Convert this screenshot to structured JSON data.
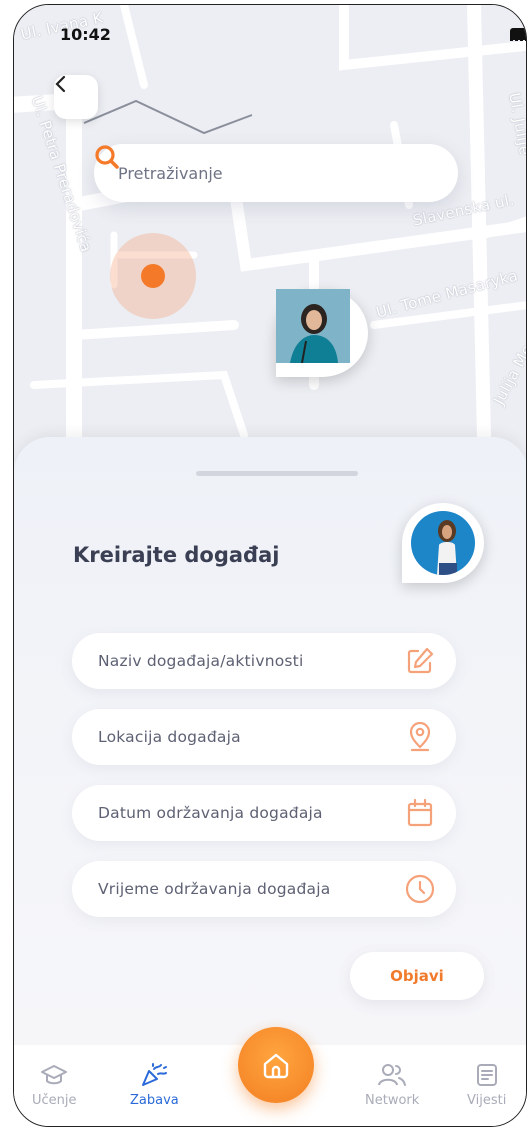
{
  "status_bar": {
    "time": "10:42"
  },
  "map": {
    "streets": [
      "Ul. Ivana K",
      "Ul. Petra Preradovića",
      "Slavenska ul.",
      "Ul. Tome Masaryka",
      "Julija Merlić",
      "Ul. Julije"
    ]
  },
  "search": {
    "placeholder": "Pretraživanje"
  },
  "sheet": {
    "title": "Kreirajte događaj",
    "fields": [
      {
        "label": "Naziv događaja/aktivnosti",
        "icon": "edit-icon"
      },
      {
        "label": "Lokacija događaja",
        "icon": "location-pin-icon"
      },
      {
        "label": "Datum održavanja događaja",
        "icon": "calendar-icon"
      },
      {
        "label": "Vrijeme održavanja događaja",
        "icon": "clock-icon"
      }
    ],
    "publish_label": "Objavi"
  },
  "nav": {
    "items": [
      {
        "label": "Učenje",
        "icon": "graduation-cap-icon"
      },
      {
        "label": "Zabava",
        "icon": "party-popper-icon",
        "active": true
      },
      {
        "label": "Network",
        "icon": "users-icon"
      },
      {
        "label": "Vijesti",
        "icon": "news-icon"
      }
    ],
    "home_icon": "home-icon"
  },
  "colors": {
    "accent": "#f47a2a",
    "active_nav": "#2b6ad8",
    "text_dark": "#3b3f53"
  }
}
